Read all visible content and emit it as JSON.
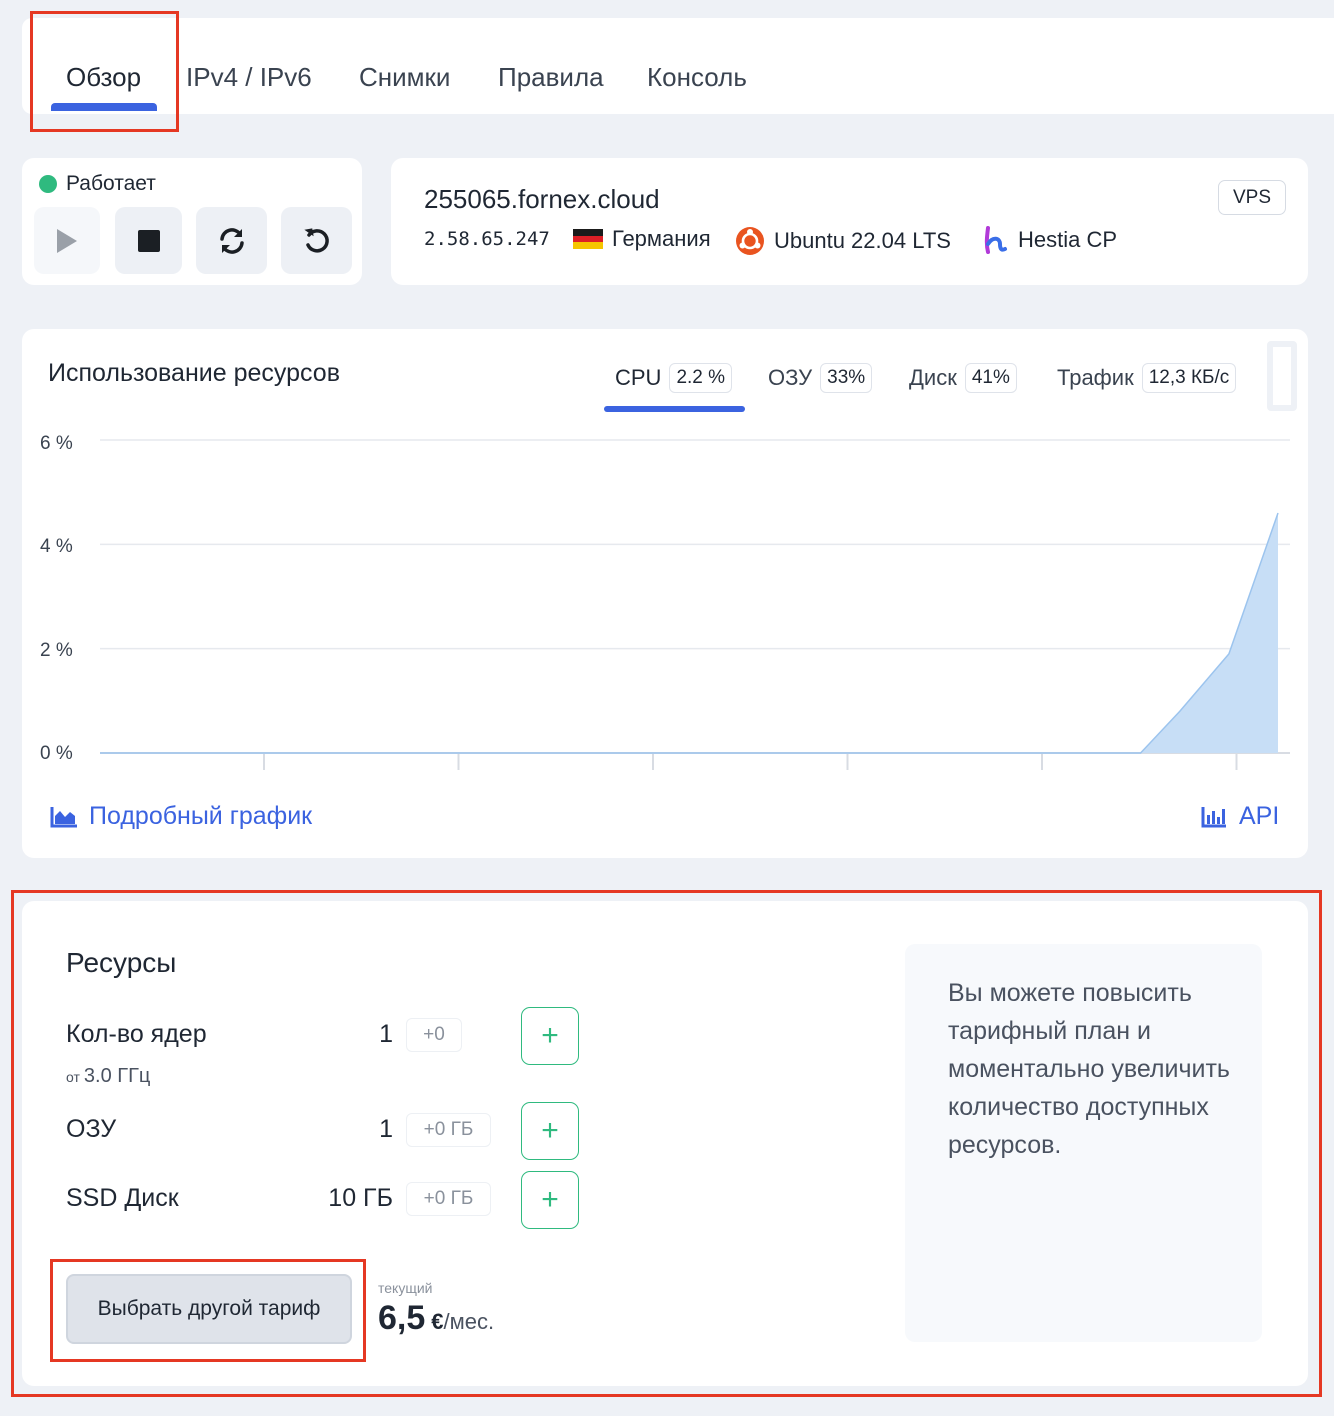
{
  "tabs": [
    "Обзор",
    "IPv4 / IPv6",
    "Снимки",
    "Правила",
    "Консоль"
  ],
  "status": {
    "label": "Работает",
    "color": "#2fba7f"
  },
  "server": {
    "hostname": "255065.fornex.cloud",
    "type_badge": "VPS",
    "ip": "2.58.65.247",
    "country": "Германия",
    "os": "Ubuntu 22.04 LTS",
    "panel": "Hestia CP"
  },
  "usage": {
    "title": "Использование ресурсов",
    "metrics": [
      {
        "label": "CPU",
        "value": "2.2 %"
      },
      {
        "label": "ОЗУ",
        "value": "33%"
      },
      {
        "label": "Диск",
        "value": "41%"
      },
      {
        "label": "Трафик",
        "value": "12,3 КБ/с"
      }
    ],
    "detail_link": "Подробный график",
    "api_link": "API"
  },
  "chart_data": {
    "type": "area",
    "ylim": [
      0,
      6
    ],
    "yticks": [
      "6 %",
      "4 %",
      "2 %",
      "0 %"
    ],
    "x": [
      0,
      1,
      2,
      3,
      4,
      5,
      6,
      7,
      8,
      9,
      10,
      10.6,
      11,
      11.5,
      12
    ],
    "values": [
      0,
      0,
      0,
      0,
      0,
      0,
      0,
      0,
      0,
      0,
      0,
      0,
      0.8,
      1.9,
      4.6
    ],
    "color": "#c7def6",
    "line_color": "#9cc4ee",
    "grid": true
  },
  "resources": {
    "title": "Ресурсы",
    "cores": {
      "label": "Кол-во ядер",
      "value": "1",
      "delta": "+0",
      "sub_prefix": "от",
      "sub": "3.0 ГГц"
    },
    "ram": {
      "label": "ОЗУ",
      "value": "1",
      "delta": "+0 ГБ"
    },
    "disk": {
      "label": "SSD Диск",
      "value": "10 ГБ",
      "delta": "+0 ГБ"
    },
    "plus_label": "+",
    "tariff_button": "Выбрать другой тариф",
    "price_caption": "текущий",
    "price": "6,5",
    "currency": "€",
    "period": "/мес.",
    "upgrade_text": "Вы можете повысить тарифный план и моментально увеличить количество доступных ресурсов."
  },
  "colors": {
    "accent": "#3b63e0",
    "highlight": "#e53823",
    "success": "#2fba7f"
  }
}
